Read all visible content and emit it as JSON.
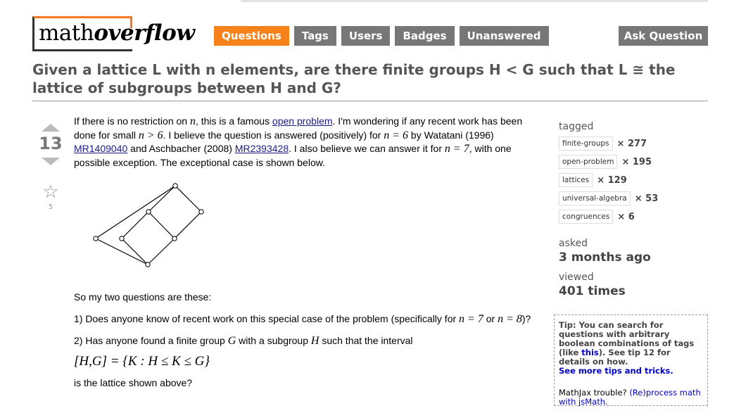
{
  "logo": {
    "part1": "math",
    "part2": "overflow"
  },
  "nav": {
    "questions": "Questions",
    "tags": "Tags",
    "users": "Users",
    "badges": "Badges",
    "unanswered": "Unanswered",
    "ask": "Ask Question"
  },
  "question": {
    "title": "Given a lattice L with n elements, are there finite groups H < G such that L ≅ the lattice of subgroups between H and G?",
    "votes": "13",
    "favorites": "5"
  },
  "body": {
    "p1_a": "If there is no restriction on ",
    "p1_n1": "n",
    "p1_b": ", this is a famous ",
    "p1_link": "open problem",
    "p1_c": ". I'm wondering if any recent work has been done for small ",
    "p1_m1": "n > 6",
    "p1_d": ". I believe the question is answered (positively) for ",
    "p1_m2": "n = 6",
    "p1_e": " by Watatani (1996) ",
    "p1_mr1": "MR1409040",
    "p1_f": " and Aschbacher (2008) ",
    "p1_mr2": "MR2393428",
    "p1_g": ". I also believe we can answer it for ",
    "p1_m3": "n = 7",
    "p1_h": ", with one possible exception. The exceptional case is shown below.",
    "p2": "So my two questions are these:",
    "q1_a": "1) Does anyone know of recent work on this special case of the problem (specifically for ",
    "q1_m1": "n = 7",
    "q1_b": " or ",
    "q1_m2": "n = 8",
    "q1_c": ")?",
    "q2_a": "2) Has anyone found a finite group ",
    "q2_g": "G",
    "q2_b": " with a subgroup ",
    "q2_h": "H",
    "q2_c": " such that the interval",
    "formula": "[H,G] = {K : H ≤ K ≤ G}",
    "q3": "is the lattice shown above?"
  },
  "sidebar": {
    "tagged_label": "tagged",
    "tags": [
      {
        "name": "finite-groups",
        "count": "× 277"
      },
      {
        "name": "open-problem",
        "count": "× 195"
      },
      {
        "name": "lattices",
        "count": "× 129"
      },
      {
        "name": "universal-algebra",
        "count": "× 53"
      },
      {
        "name": "congruences",
        "count": "× 6"
      }
    ],
    "asked_label": "asked",
    "asked_value": "3 months ago",
    "viewed_label": "viewed",
    "viewed_value": "401 times"
  },
  "tip": {
    "text_a": "Tip: You can search for questions with arbitrary boolean combinations of tags (like ",
    "link_this": "this",
    "text_b": "). See tip 12 for details on how.",
    "more": "See more tips and tricks.",
    "mj_a": "MathJax trouble? ",
    "mj_link": "(Re)process math with jsMath",
    "mj_b": "."
  }
}
